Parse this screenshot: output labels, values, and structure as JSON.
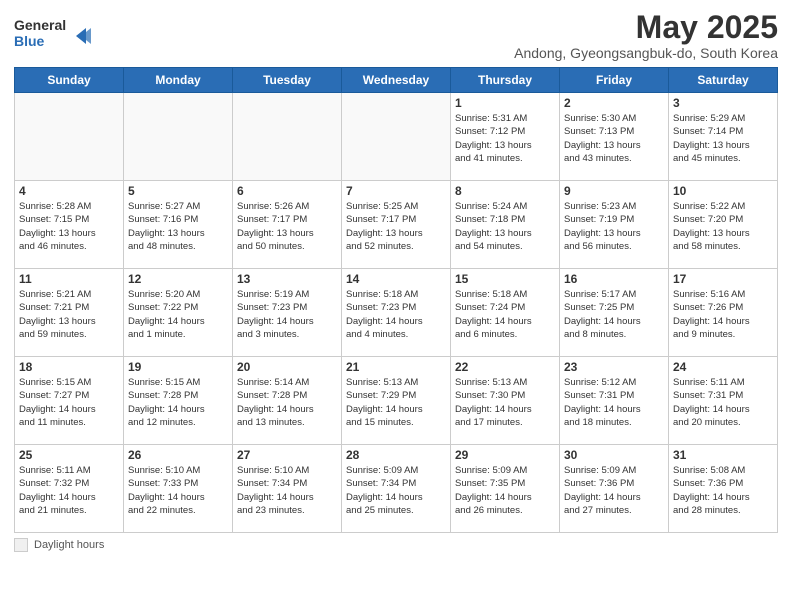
{
  "header": {
    "logo_line1": "General",
    "logo_line2": "Blue",
    "month_title": "May 2025",
    "subtitle": "Andong, Gyeongsangbuk-do, South Korea"
  },
  "days_of_week": [
    "Sunday",
    "Monday",
    "Tuesday",
    "Wednesday",
    "Thursday",
    "Friday",
    "Saturday"
  ],
  "footer": {
    "daylight_label": "Daylight hours"
  },
  "weeks": [
    [
      {
        "day": "",
        "info": ""
      },
      {
        "day": "",
        "info": ""
      },
      {
        "day": "",
        "info": ""
      },
      {
        "day": "",
        "info": ""
      },
      {
        "day": "1",
        "info": "Sunrise: 5:31 AM\nSunset: 7:12 PM\nDaylight: 13 hours\nand 41 minutes."
      },
      {
        "day": "2",
        "info": "Sunrise: 5:30 AM\nSunset: 7:13 PM\nDaylight: 13 hours\nand 43 minutes."
      },
      {
        "day": "3",
        "info": "Sunrise: 5:29 AM\nSunset: 7:14 PM\nDaylight: 13 hours\nand 45 minutes."
      }
    ],
    [
      {
        "day": "4",
        "info": "Sunrise: 5:28 AM\nSunset: 7:15 PM\nDaylight: 13 hours\nand 46 minutes."
      },
      {
        "day": "5",
        "info": "Sunrise: 5:27 AM\nSunset: 7:16 PM\nDaylight: 13 hours\nand 48 minutes."
      },
      {
        "day": "6",
        "info": "Sunrise: 5:26 AM\nSunset: 7:17 PM\nDaylight: 13 hours\nand 50 minutes."
      },
      {
        "day": "7",
        "info": "Sunrise: 5:25 AM\nSunset: 7:17 PM\nDaylight: 13 hours\nand 52 minutes."
      },
      {
        "day": "8",
        "info": "Sunrise: 5:24 AM\nSunset: 7:18 PM\nDaylight: 13 hours\nand 54 minutes."
      },
      {
        "day": "9",
        "info": "Sunrise: 5:23 AM\nSunset: 7:19 PM\nDaylight: 13 hours\nand 56 minutes."
      },
      {
        "day": "10",
        "info": "Sunrise: 5:22 AM\nSunset: 7:20 PM\nDaylight: 13 hours\nand 58 minutes."
      }
    ],
    [
      {
        "day": "11",
        "info": "Sunrise: 5:21 AM\nSunset: 7:21 PM\nDaylight: 13 hours\nand 59 minutes."
      },
      {
        "day": "12",
        "info": "Sunrise: 5:20 AM\nSunset: 7:22 PM\nDaylight: 14 hours\nand 1 minute."
      },
      {
        "day": "13",
        "info": "Sunrise: 5:19 AM\nSunset: 7:23 PM\nDaylight: 14 hours\nand 3 minutes."
      },
      {
        "day": "14",
        "info": "Sunrise: 5:18 AM\nSunset: 7:23 PM\nDaylight: 14 hours\nand 4 minutes."
      },
      {
        "day": "15",
        "info": "Sunrise: 5:18 AM\nSunset: 7:24 PM\nDaylight: 14 hours\nand 6 minutes."
      },
      {
        "day": "16",
        "info": "Sunrise: 5:17 AM\nSunset: 7:25 PM\nDaylight: 14 hours\nand 8 minutes."
      },
      {
        "day": "17",
        "info": "Sunrise: 5:16 AM\nSunset: 7:26 PM\nDaylight: 14 hours\nand 9 minutes."
      }
    ],
    [
      {
        "day": "18",
        "info": "Sunrise: 5:15 AM\nSunset: 7:27 PM\nDaylight: 14 hours\nand 11 minutes."
      },
      {
        "day": "19",
        "info": "Sunrise: 5:15 AM\nSunset: 7:28 PM\nDaylight: 14 hours\nand 12 minutes."
      },
      {
        "day": "20",
        "info": "Sunrise: 5:14 AM\nSunset: 7:28 PM\nDaylight: 14 hours\nand 13 minutes."
      },
      {
        "day": "21",
        "info": "Sunrise: 5:13 AM\nSunset: 7:29 PM\nDaylight: 14 hours\nand 15 minutes."
      },
      {
        "day": "22",
        "info": "Sunrise: 5:13 AM\nSunset: 7:30 PM\nDaylight: 14 hours\nand 17 minutes."
      },
      {
        "day": "23",
        "info": "Sunrise: 5:12 AM\nSunset: 7:31 PM\nDaylight: 14 hours\nand 18 minutes."
      },
      {
        "day": "24",
        "info": "Sunrise: 5:11 AM\nSunset: 7:31 PM\nDaylight: 14 hours\nand 20 minutes."
      }
    ],
    [
      {
        "day": "25",
        "info": "Sunrise: 5:11 AM\nSunset: 7:32 PM\nDaylight: 14 hours\nand 21 minutes."
      },
      {
        "day": "26",
        "info": "Sunrise: 5:10 AM\nSunset: 7:33 PM\nDaylight: 14 hours\nand 22 minutes."
      },
      {
        "day": "27",
        "info": "Sunrise: 5:10 AM\nSunset: 7:34 PM\nDaylight: 14 hours\nand 23 minutes."
      },
      {
        "day": "28",
        "info": "Sunrise: 5:09 AM\nSunset: 7:34 PM\nDaylight: 14 hours\nand 25 minutes."
      },
      {
        "day": "29",
        "info": "Sunrise: 5:09 AM\nSunset: 7:35 PM\nDaylight: 14 hours\nand 26 minutes."
      },
      {
        "day": "30",
        "info": "Sunrise: 5:09 AM\nSunset: 7:36 PM\nDaylight: 14 hours\nand 27 minutes."
      },
      {
        "day": "31",
        "info": "Sunrise: 5:08 AM\nSunset: 7:36 PM\nDaylight: 14 hours\nand 28 minutes."
      }
    ]
  ]
}
